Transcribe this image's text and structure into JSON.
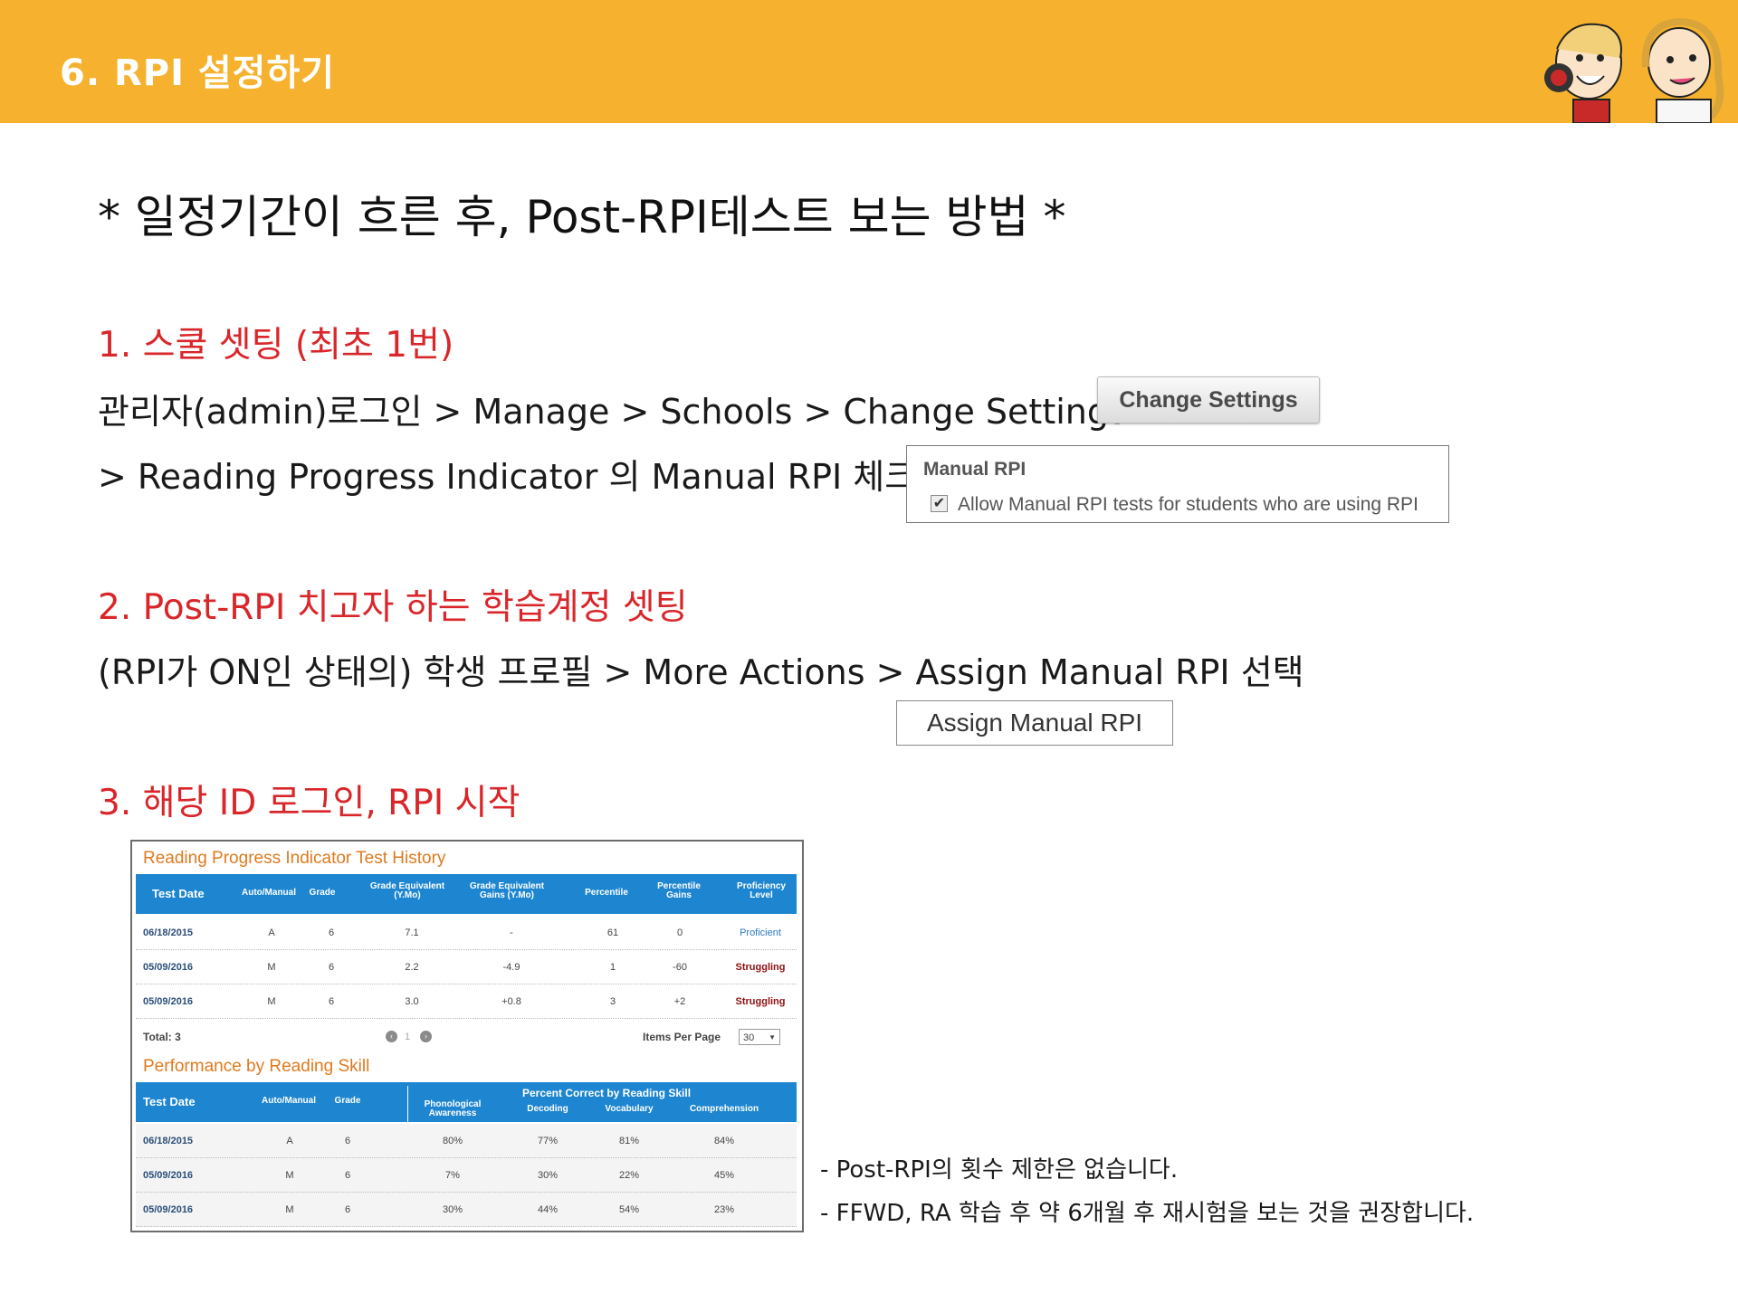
{
  "header": {
    "title": "6. RPI 설정하기",
    "color": "#f6b22e"
  },
  "main_title": "* 일정기간이 흐른 후, Post-RPI테스트 보는 방법 *",
  "section1": {
    "title": "1. 스쿨 셋팅 (최초 1번)",
    "line1": "관리자(admin)로그인 > Manage > Schools > Change Settings",
    "button": "Change Settings",
    "line2": "> Reading Progress Indicator 의 Manual RPI 체크",
    "manual_box": {
      "title": "Manual RPI",
      "check": "✔",
      "label": "Allow Manual RPI tests for students who are using RPI"
    }
  },
  "section2": {
    "title": "2. Post-RPI 치고자 하는 학습계정 셋팅",
    "line1": "(RPI가 ON인 상태의) 학생 프로필 > More Actions > Assign Manual RPI 선택",
    "button": "Assign Manual RPI"
  },
  "section3": {
    "title": "3. 해당 ID 로그인, RPI 시작"
  },
  "history": {
    "title": "Reading Progress Indicator Test History",
    "headers": [
      "Test Date",
      "Auto/Manual",
      "Grade",
      "Grade Equivalent (Y.Mo)",
      "Grade Equivalent Gains (Y.Mo)",
      "Percentile",
      "Percentile Gains",
      "Proficiency Level"
    ],
    "rows": [
      [
        "06/18/2015",
        "A",
        "6",
        "7.1",
        "-",
        "61",
        "0",
        "Proficient"
      ],
      [
        "05/09/2016",
        "M",
        "6",
        "2.2",
        "-4.9",
        "1",
        "-60",
        "Struggling"
      ],
      [
        "05/09/2016",
        "M",
        "6",
        "3.0",
        "+0.8",
        "3",
        "+2",
        "Struggling"
      ]
    ],
    "total": "Total: 3",
    "page": "1",
    "items_per_page_label": "Items Per Page",
    "items_per_page": "30"
  },
  "performance": {
    "title": "Performance by Reading Skill",
    "group_header": "Percent Correct by Reading Skill",
    "headers": [
      "Test Date",
      "Auto/Manual",
      "Grade",
      "Phonological Awareness",
      "Decoding",
      "Vocabulary",
      "Comprehension"
    ],
    "rows": [
      [
        "06/18/2015",
        "A",
        "6",
        "80%",
        "77%",
        "81%",
        "84%"
      ],
      [
        "05/09/2016",
        "M",
        "6",
        "7%",
        "30%",
        "22%",
        "45%"
      ],
      [
        "05/09/2016",
        "M",
        "6",
        "30%",
        "44%",
        "54%",
        "23%"
      ]
    ]
  },
  "notes": [
    "- Post-RPI의 횟수 제한은 없습니다.",
    "- FFWD, RA 학습 후 약 6개월 후 재시험을 보는 것을 권장합니다."
  ]
}
